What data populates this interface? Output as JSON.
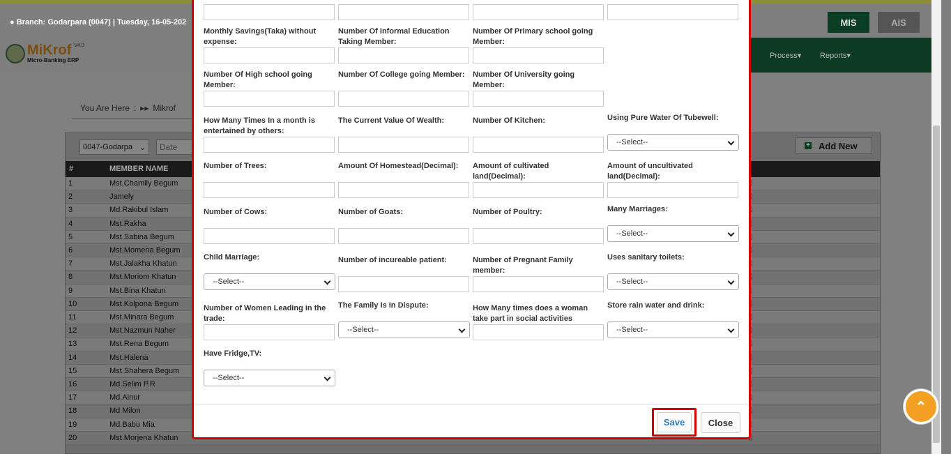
{
  "header": {
    "branch_info": "Branch: Godarpara (0047) | Tuesday, 16-05-202",
    "mis_label": "MIS",
    "ais_label": "AIS"
  },
  "logo": {
    "name": "MiKrof",
    "version": "V4.0",
    "subtitle": "Micro-Banking ERP"
  },
  "nav": {
    "process": "Process",
    "reports": "Reports"
  },
  "breadcrumb": {
    "you_are_here": "You Are Here",
    "sep": ":",
    "current": "Mikrof"
  },
  "filters": {
    "branch_value": "0047-Godarpa",
    "date_placeholder": "Date",
    "add_new": "Add New"
  },
  "table": {
    "col_num": "#",
    "col_name": "MEMBER NAME",
    "rows": [
      {
        "n": "1",
        "name": "Mst.Chamily Begum"
      },
      {
        "n": "2",
        "name": "Jamely"
      },
      {
        "n": "3",
        "name": "Md.Rakibul Islam"
      },
      {
        "n": "4",
        "name": "Mst.Rakha"
      },
      {
        "n": "5",
        "name": "Mst.Sabina Begum"
      },
      {
        "n": "6",
        "name": "Mst.Momena Begum"
      },
      {
        "n": "7",
        "name": "Mst.Jalakha Khatun"
      },
      {
        "n": "8",
        "name": "Mst.Moriom Khatun"
      },
      {
        "n": "9",
        "name": "Mst.Bina Khatun"
      },
      {
        "n": "10",
        "name": "Mst.Kolpona Begum"
      },
      {
        "n": "11",
        "name": "Mst.Minara Begum"
      },
      {
        "n": "12",
        "name": "Mst.Nazmun Naher"
      },
      {
        "n": "13",
        "name": "Mst.Rena Begum"
      },
      {
        "n": "14",
        "name": "Mst.Halena"
      },
      {
        "n": "15",
        "name": "Mst.Shahera Begum"
      },
      {
        "n": "16",
        "name": "Md.Selim P.R"
      },
      {
        "n": "17",
        "name": "Md.Ainur"
      },
      {
        "n": "18",
        "name": "Md Milon"
      },
      {
        "n": "19",
        "name": "Md.Babu Mia"
      },
      {
        "n": "20",
        "name": "Mst.Morjena Khatun"
      }
    ]
  },
  "form": {
    "select_placeholder": "--Select--",
    "fields": {
      "monthly_savings": "Monthly Savings(Taka) without expense:",
      "informal_edu": "Number Of Informal Education Taking Member:",
      "primary_school": "Number Of Primary school going Member:",
      "high_school": "Number Of High school going Member:",
      "college": "Number Of College going Member:",
      "university": "Number Of University going Member:",
      "entertained": "How Many Times In a month is entertained by others:",
      "wealth": "The Current Value Of Wealth:",
      "kitchen": "Number Of Kitchen:",
      "tubewell": "Using Pure Water Of Tubewell:",
      "trees": "Number of Trees:",
      "homestead": "Amount Of Homestead(Decimal):",
      "cultivated": "Amount of cultivated land(Decimal):",
      "uncultivated": "Amount of uncultivated land(Decimal):",
      "cows": "Number of Cows:",
      "goats": "Number of Goats:",
      "poultry": "Number of Poultry:",
      "marriages": "Many Marriages:",
      "child_marriage": "Child Marriage:",
      "incurable": "Number of incureable patient:",
      "pregnant": "Number of Pregnant Family member:",
      "sanitary": "Uses sanitary toilets:",
      "women_trade": "Number of Women Leading in the trade:",
      "dispute": "The Family Is In Dispute:",
      "woman_social": "How Many times does a woman take part in social activities",
      "rain_water": "Store rain water and drink:",
      "fridge_tv": "Have Fridge,TV:"
    }
  },
  "buttons": {
    "save": "Save",
    "close": "Close"
  }
}
